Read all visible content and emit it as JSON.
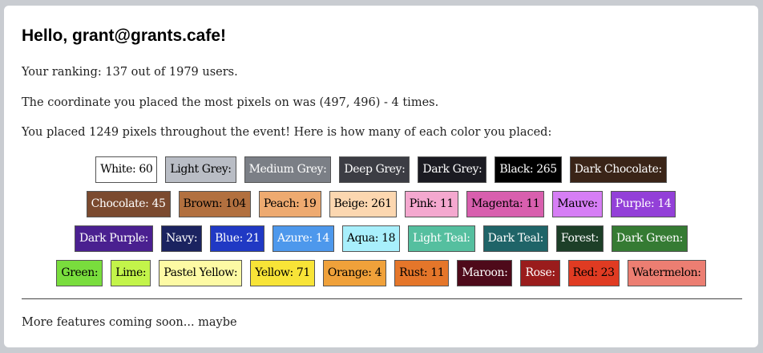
{
  "header": {
    "greeting": "Hello, grant@grants.cafe!"
  },
  "stats": {
    "ranking": "Your ranking: 137 out of 1979 users.",
    "coordinate": "The coordinate you placed the most pixels on was (497, 496) - 4 times.",
    "placed": "You placed 1249 pixels throughout the event! Here is how many of each color you placed:"
  },
  "colors": [
    [
      {
        "label": "White: 60",
        "bg": "#ffffff",
        "fg": "#000000"
      },
      {
        "label": "Light Grey:",
        "bg": "#b9bdc5",
        "fg": "#000000"
      },
      {
        "label": "Medium Grey:",
        "bg": "#7b7f86",
        "fg": "#ffffff"
      },
      {
        "label": "Deep Grey:",
        "bg": "#3c3d44",
        "fg": "#ffffff"
      },
      {
        "label": "Dark Grey:",
        "bg": "#1b1b22",
        "fg": "#ffffff"
      },
      {
        "label": "Black: 265",
        "bg": "#000000",
        "fg": "#ffffff"
      },
      {
        "label": "Dark Chocolate:",
        "bg": "#3a2417",
        "fg": "#ffffff"
      }
    ],
    [
      {
        "label": "Chocolate: 45",
        "bg": "#7b4a2f",
        "fg": "#ffffff"
      },
      {
        "label": "Brown: 104",
        "bg": "#b2703f",
        "fg": "#000000"
      },
      {
        "label": "Peach: 19",
        "bg": "#eeaa70",
        "fg": "#000000"
      },
      {
        "label": "Beige: 261",
        "bg": "#fcd7b0",
        "fg": "#000000"
      },
      {
        "label": "Pink: 11",
        "bg": "#f4a8cf",
        "fg": "#000000"
      },
      {
        "label": "Magenta: 11",
        "bg": "#d85fae",
        "fg": "#000000"
      },
      {
        "label": "Mauve:",
        "bg": "#d67ef5",
        "fg": "#000000"
      },
      {
        "label": "Purple: 14",
        "bg": "#9340d8",
        "fg": "#ffffff"
      }
    ],
    [
      {
        "label": "Dark Purple:",
        "bg": "#4a2090",
        "fg": "#ffffff"
      },
      {
        "label": "Navy:",
        "bg": "#1b2360",
        "fg": "#ffffff"
      },
      {
        "label": "Blue: 21",
        "bg": "#2039c4",
        "fg": "#ffffff"
      },
      {
        "label": "Azure: 14",
        "bg": "#4d98ec",
        "fg": "#ffffff"
      },
      {
        "label": "Aqua: 18",
        "bg": "#a8effc",
        "fg": "#000000"
      },
      {
        "label": "Light Teal:",
        "bg": "#55bf9f",
        "fg": "#ffffff"
      },
      {
        "label": "Dark Teal:",
        "bg": "#1f6468",
        "fg": "#ffffff"
      },
      {
        "label": "Forest:",
        "bg": "#1d3f28",
        "fg": "#ffffff"
      },
      {
        "label": "Dark Green:",
        "bg": "#357b33",
        "fg": "#ffffff"
      }
    ],
    [
      {
        "label": "Green:",
        "bg": "#79dd3d",
        "fg": "#000000"
      },
      {
        "label": "Lime:",
        "bg": "#c3f44a",
        "fg": "#000000"
      },
      {
        "label": "Pastel Yellow:",
        "bg": "#fdfaa4",
        "fg": "#000000"
      },
      {
        "label": "Yellow: 71",
        "bg": "#f8e437",
        "fg": "#000000"
      },
      {
        "label": "Orange: 4",
        "bg": "#f0a13a",
        "fg": "#000000"
      },
      {
        "label": "Rust: 11",
        "bg": "#e5762a",
        "fg": "#000000"
      },
      {
        "label": "Maroon:",
        "bg": "#4e0a1a",
        "fg": "#ffffff"
      },
      {
        "label": "Rose:",
        "bg": "#9a1c1c",
        "fg": "#ffffff"
      },
      {
        "label": "Red: 23",
        "bg": "#e03b22",
        "fg": "#000000"
      },
      {
        "label": "Watermelon:",
        "bg": "#ec7e72",
        "fg": "#000000"
      }
    ]
  ],
  "footer": {
    "text": "More features coming soon... maybe"
  }
}
